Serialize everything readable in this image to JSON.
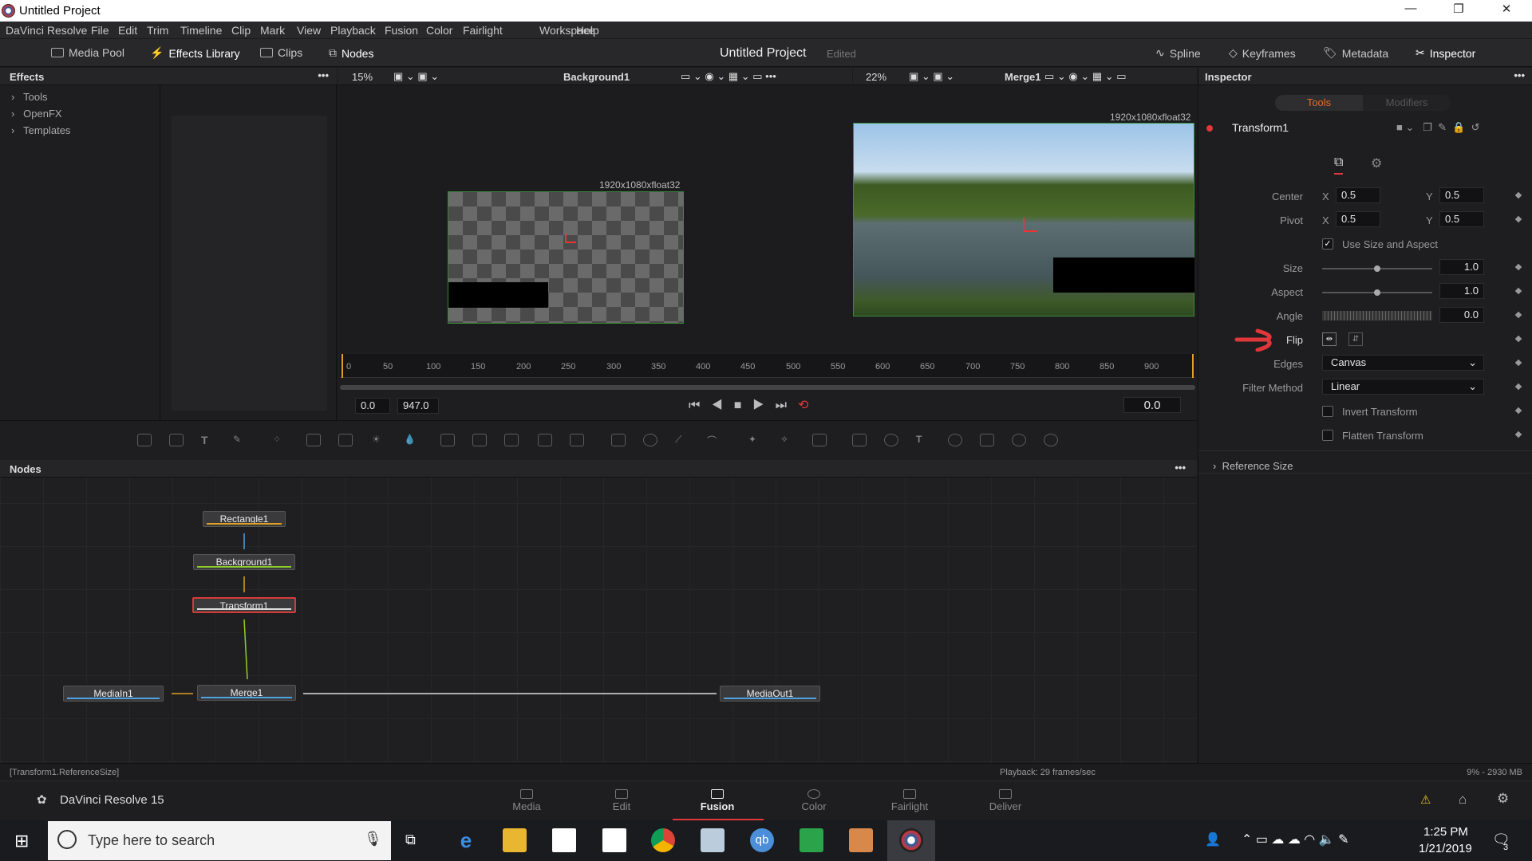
{
  "window": {
    "title": "Untitled Project",
    "minimize": "—",
    "maximize": "❐",
    "close": "✕"
  },
  "menu": [
    "DaVinci Resolve",
    "File",
    "Edit",
    "Trim",
    "Timeline",
    "Clip",
    "Mark",
    "View",
    "Playback",
    "Fusion",
    "Color",
    "Fairlight",
    "Workspace",
    "Help"
  ],
  "toolbar": {
    "media_pool": "Media Pool",
    "effects_library": "Effects Library",
    "clips": "Clips",
    "nodes": "Nodes",
    "project_title": "Untitled Project",
    "edited": "Edited",
    "spline": "Spline",
    "keyframes": "Keyframes",
    "metadata": "Metadata",
    "inspector": "Inspector"
  },
  "effects": {
    "header": "Effects",
    "items": [
      "Tools",
      "OpenFX",
      "Templates"
    ]
  },
  "viewer1": {
    "zoom": "15%",
    "name": "Background1",
    "resolution": "1920x1080xfloat32"
  },
  "viewer2": {
    "zoom": "22%",
    "name": "Merge1",
    "resolution": "1920x1080xfloat32"
  },
  "timeline": {
    "ticks": [
      "0",
      "50",
      "100",
      "150",
      "200",
      "250",
      "300",
      "350",
      "400",
      "450",
      "500",
      "550",
      "600",
      "650",
      "700",
      "750",
      "800",
      "850",
      "900"
    ],
    "start": "0.0",
    "end": "947.0",
    "current": "0.0"
  },
  "nodes_panel": {
    "header": "Nodes",
    "nodes": [
      "Rectangle1",
      "Background1",
      "Transform1",
      "MediaIn1",
      "Merge1",
      "MediaOut1"
    ]
  },
  "inspector": {
    "header": "Inspector",
    "tab_tools": "Tools",
    "tab_modifiers": "Modifiers",
    "tool_name": "Transform1",
    "center_label": "Center",
    "center_x": "0.5",
    "center_y": "0.5",
    "pivot_label": "Pivot",
    "pivot_x": "0.5",
    "pivot_y": "0.5",
    "x": "X",
    "y": "Y",
    "use_size_aspect": "Use Size and Aspect",
    "size_label": "Size",
    "size": "1.0",
    "size_level": 0.5,
    "aspect_label": "Aspect",
    "aspect": "1.0",
    "aspect_level": 0.5,
    "angle_label": "Angle",
    "angle": "0.0",
    "flip_label": "Flip",
    "edges_label": "Edges",
    "edges": "Canvas",
    "filter_label": "Filter Method",
    "filter": "Linear",
    "invert": "Invert Transform",
    "flatten": "Flatten Transform",
    "reference_size": "Reference Size"
  },
  "status": {
    "left": "[Transform1.ReferenceSize]",
    "playback": "Playback: 29 frames/sec",
    "memory": "9% - 2930 MB"
  },
  "pages": {
    "app": "DaVinci Resolve 15",
    "items": [
      "Media",
      "Edit",
      "Fusion",
      "Color",
      "Fairlight",
      "Deliver"
    ],
    "active": "Fusion"
  },
  "taskbar": {
    "search_placeholder": "Type here to search",
    "time": "1:25 PM",
    "date": "1/21/2019",
    "notifications": "3"
  },
  "colors": {
    "accent": "#e0373a",
    "active_tab": "#e06c2a",
    "selected_node": "#d33b3b",
    "green_wire": "#8fcf2a"
  }
}
